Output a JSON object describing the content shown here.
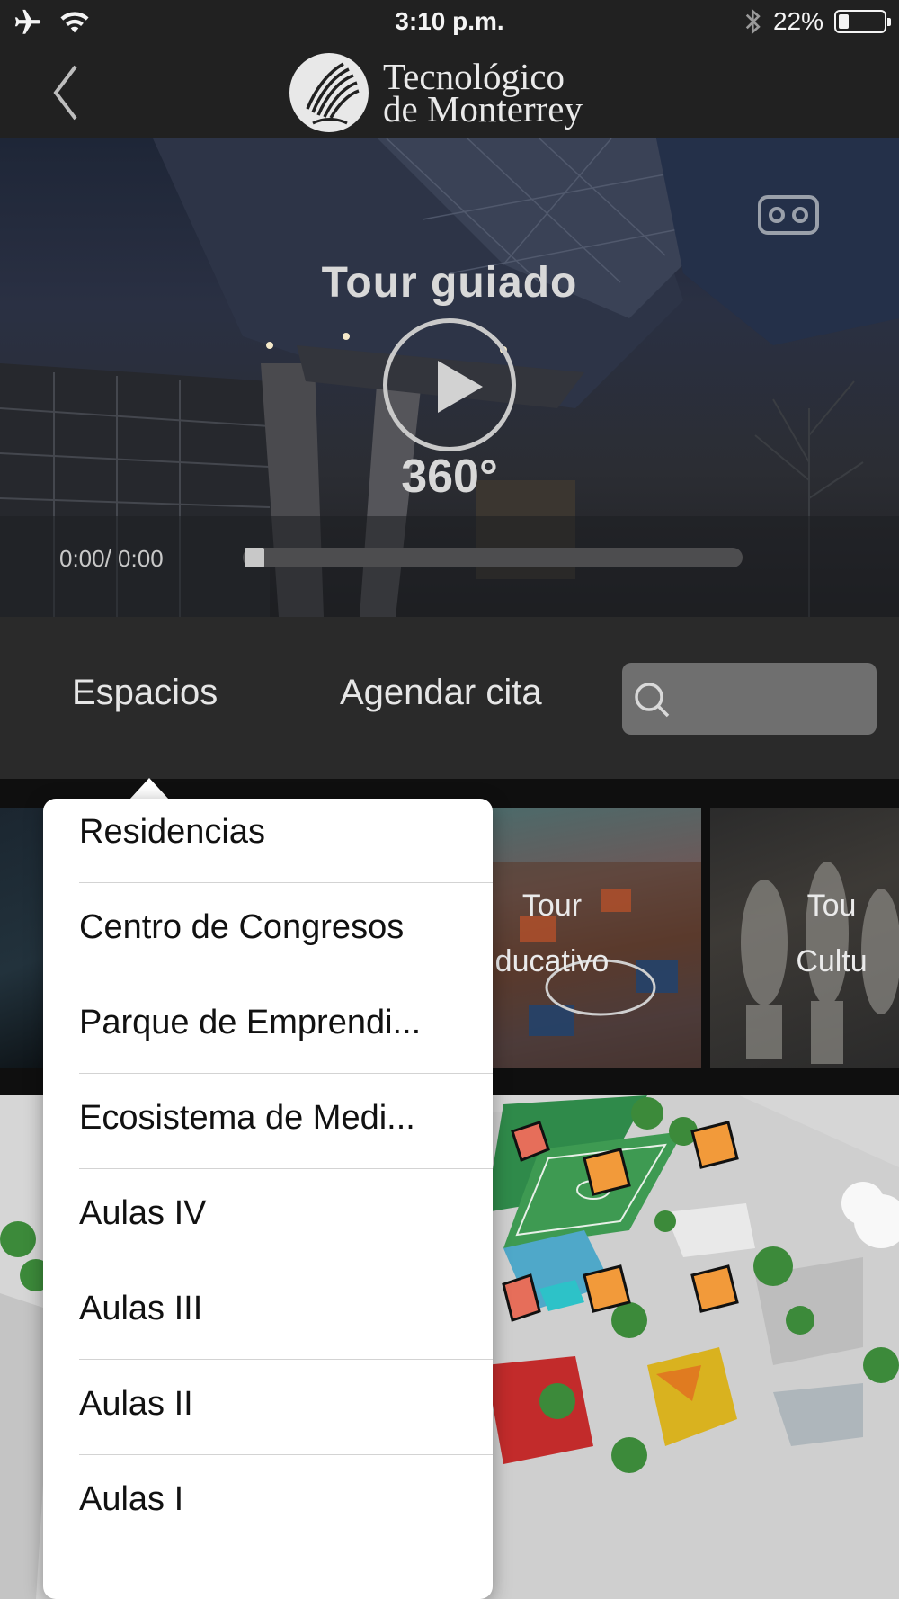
{
  "status_bar": {
    "time": "3:10 p.m.",
    "battery_percent_label": "22%",
    "battery_level": 0.22,
    "icons": [
      "airplane-icon",
      "wifi-icon",
      "bluetooth-icon",
      "battery-icon"
    ]
  },
  "nav": {
    "back_icon": "chevron-left-icon",
    "brand_line1": "Tecnológico",
    "brand_line2": "de Monterrey"
  },
  "hero": {
    "title": "Tour guiado",
    "degrees": "360°",
    "time": "0:00/ 0:00",
    "progress": 0
  },
  "segments": {
    "spaces_label": "Espacios",
    "appointment_label": "Agendar cita",
    "search_placeholder": ""
  },
  "cards": [
    {
      "line1": "Tour",
      "line2": "ducativo"
    },
    {
      "line1": "Tou",
      "line2": "Cultu"
    }
  ],
  "menu": {
    "items": [
      "Residencias",
      "Centro de Congresos",
      "Parque de Emprendi...",
      "Ecosistema de Medi...",
      "Aulas IV",
      "Aulas III",
      "Aulas II",
      "Aulas I"
    ]
  },
  "colors": {
    "bar_bg": "#212121",
    "segment_bg": "#2a2a2a",
    "search_bg": "#6f6f6f",
    "popover_bg": "#ffffff"
  }
}
